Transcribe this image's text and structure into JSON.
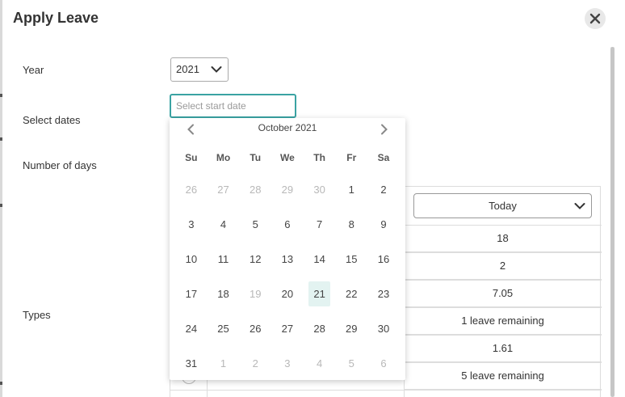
{
  "dialog": {
    "title": "Apply Leave"
  },
  "form": {
    "year_label": "Year",
    "year_value": "2021",
    "dates_label": "Select dates",
    "dates_placeholder": "Select start date",
    "days_label": "Number of days",
    "types_label": "Types"
  },
  "table": {
    "period_select": "Today",
    "values": [
      "18",
      "2",
      "7.05",
      "1 leave remaining",
      "1.61",
      "5 leave remaining"
    ]
  },
  "calendar": {
    "month_title": "October 2021",
    "weekdays": [
      "Su",
      "Mo",
      "Tu",
      "We",
      "Th",
      "Fr",
      "Sa"
    ],
    "days": [
      {
        "d": "26",
        "muted": true
      },
      {
        "d": "27",
        "muted": true
      },
      {
        "d": "28",
        "muted": true
      },
      {
        "d": "29",
        "muted": true
      },
      {
        "d": "30",
        "muted": true
      },
      {
        "d": "1"
      },
      {
        "d": "2"
      },
      {
        "d": "3"
      },
      {
        "d": "4"
      },
      {
        "d": "5"
      },
      {
        "d": "6"
      },
      {
        "d": "7"
      },
      {
        "d": "8"
      },
      {
        "d": "9"
      },
      {
        "d": "10"
      },
      {
        "d": "11"
      },
      {
        "d": "12"
      },
      {
        "d": "13"
      },
      {
        "d": "14"
      },
      {
        "d": "15"
      },
      {
        "d": "16"
      },
      {
        "d": "17"
      },
      {
        "d": "18"
      },
      {
        "d": "19",
        "muted": true
      },
      {
        "d": "20"
      },
      {
        "d": "21",
        "today": true
      },
      {
        "d": "22"
      },
      {
        "d": "23"
      },
      {
        "d": "24"
      },
      {
        "d": "25"
      },
      {
        "d": "26"
      },
      {
        "d": "27"
      },
      {
        "d": "28"
      },
      {
        "d": "29"
      },
      {
        "d": "30"
      },
      {
        "d": "31"
      },
      {
        "d": "1",
        "muted": true
      },
      {
        "d": "2",
        "muted": true
      },
      {
        "d": "3",
        "muted": true
      },
      {
        "d": "4",
        "muted": true
      },
      {
        "d": "5",
        "muted": true
      },
      {
        "d": "6",
        "muted": true
      }
    ],
    "today_highlight": "#e3f3f1"
  },
  "colors": {
    "accent": "#3aa3a3",
    "muted_text": "#b8b8b8"
  },
  "icons": {
    "close": "close-icon",
    "prev": "chevron-left-icon",
    "next": "chevron-right-icon",
    "dropdown": "chevron-down-icon"
  }
}
